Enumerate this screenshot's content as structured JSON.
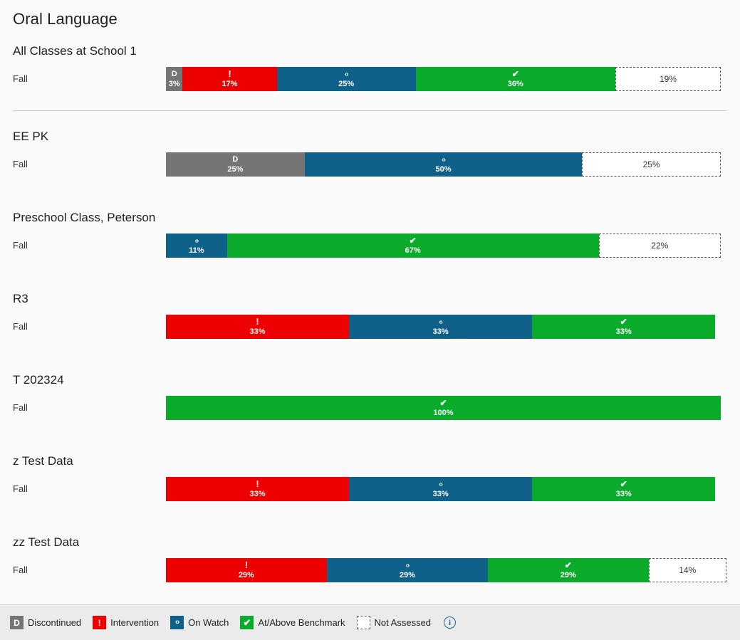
{
  "page": {
    "title": "Oral Language",
    "background": "#fafafa"
  },
  "colors": {
    "discontinued": "#757575",
    "intervention": "#ed0000",
    "onwatch": "#0f6189",
    "benchmark": "#0aab2b",
    "notassessed": "#ffffff",
    "info": "#1565a8"
  },
  "chart_data": {
    "type": "bar",
    "title": "Oral Language",
    "subtype": "100% stacked horizontal bar",
    "xlabel": "",
    "ylabel": "",
    "xlim": [
      0,
      100
    ],
    "grid": false,
    "legend_position": "bottom",
    "categories": [
      "All Classes at School 1",
      "EE PK",
      "Preschool Class, Peterson",
      "R3",
      "T 202324",
      "z Test Data",
      "zz Test Data"
    ],
    "series": [
      {
        "name": "Discontinued",
        "key": "discontinued",
        "color": "#757575",
        "values": [
          3,
          25,
          0,
          0,
          0,
          0,
          0
        ]
      },
      {
        "name": "Intervention",
        "key": "intervention",
        "color": "#ed0000",
        "values": [
          17,
          0,
          0,
          33,
          0,
          33,
          29
        ]
      },
      {
        "name": "On Watch",
        "key": "onwatch",
        "color": "#0f6189",
        "values": [
          25,
          50,
          11,
          33,
          0,
          33,
          29
        ]
      },
      {
        "name": "At/Above Benchmark",
        "key": "benchmark",
        "color": "#0aab2b",
        "values": [
          36,
          0,
          67,
          33,
          100,
          33,
          29
        ]
      },
      {
        "name": "Not Assessed",
        "key": "notassessed",
        "color": "#ffffff",
        "values": [
          19,
          25,
          22,
          0,
          0,
          0,
          14
        ]
      }
    ]
  },
  "sections": [
    {
      "title": "All Classes at School 1",
      "term": "Fall",
      "divider_after": true,
      "segments": [
        {
          "key": "discontinued",
          "icon": "D",
          "value": "3%"
        },
        {
          "key": "intervention",
          "icon": "!",
          "value": "17%"
        },
        {
          "key": "onwatch",
          "icon": "‹›",
          "value": "25%"
        },
        {
          "key": "benchmark",
          "icon": "✔",
          "value": "36%"
        },
        {
          "key": "notassessed",
          "icon": "",
          "value": "19%"
        }
      ]
    },
    {
      "title": "EE PK",
      "term": "Fall",
      "divider_after": false,
      "segments": [
        {
          "key": "discontinued",
          "icon": "D",
          "value": "25%"
        },
        {
          "key": "onwatch",
          "icon": "‹›",
          "value": "50%"
        },
        {
          "key": "notassessed",
          "icon": "",
          "value": "25%"
        }
      ]
    },
    {
      "title": "Preschool Class, Peterson",
      "term": "Fall",
      "divider_after": false,
      "segments": [
        {
          "key": "onwatch",
          "icon": "‹›",
          "value": "11%"
        },
        {
          "key": "benchmark",
          "icon": "✔",
          "value": "67%"
        },
        {
          "key": "notassessed",
          "icon": "",
          "value": "22%"
        }
      ]
    },
    {
      "title": "R3",
      "term": "Fall",
      "divider_after": false,
      "segments": [
        {
          "key": "intervention",
          "icon": "!",
          "value": "33%"
        },
        {
          "key": "onwatch",
          "icon": "‹›",
          "value": "33%"
        },
        {
          "key": "benchmark",
          "icon": "✔",
          "value": "33%"
        }
      ]
    },
    {
      "title": "T 202324",
      "term": "Fall",
      "divider_after": false,
      "segments": [
        {
          "key": "benchmark",
          "icon": "✔",
          "value": "100%"
        }
      ]
    },
    {
      "title": "z Test Data",
      "term": "Fall",
      "divider_after": false,
      "segments": [
        {
          "key": "intervention",
          "icon": "!",
          "value": "33%"
        },
        {
          "key": "onwatch",
          "icon": "‹›",
          "value": "33%"
        },
        {
          "key": "benchmark",
          "icon": "✔",
          "value": "33%"
        }
      ]
    },
    {
      "title": "zz Test Data",
      "term": "Fall",
      "divider_after": false,
      "segments": [
        {
          "key": "intervention",
          "icon": "!",
          "value": "29%"
        },
        {
          "key": "onwatch",
          "icon": "‹›",
          "value": "29%"
        },
        {
          "key": "benchmark",
          "icon": "✔",
          "value": "29%"
        },
        {
          "key": "notassessed",
          "icon": "",
          "value": "14%"
        }
      ]
    }
  ],
  "legend": {
    "items": [
      {
        "key": "discontinued",
        "icon": "D",
        "label": "Discontinued"
      },
      {
        "key": "intervention",
        "icon": "!",
        "label": "Intervention"
      },
      {
        "key": "onwatch",
        "icon": "‹›",
        "label": "On Watch"
      },
      {
        "key": "benchmark",
        "icon": "✔",
        "label": "At/Above Benchmark"
      },
      {
        "key": "notassessed",
        "icon": "",
        "label": "Not Assessed"
      }
    ],
    "info_icon_label": "i"
  }
}
